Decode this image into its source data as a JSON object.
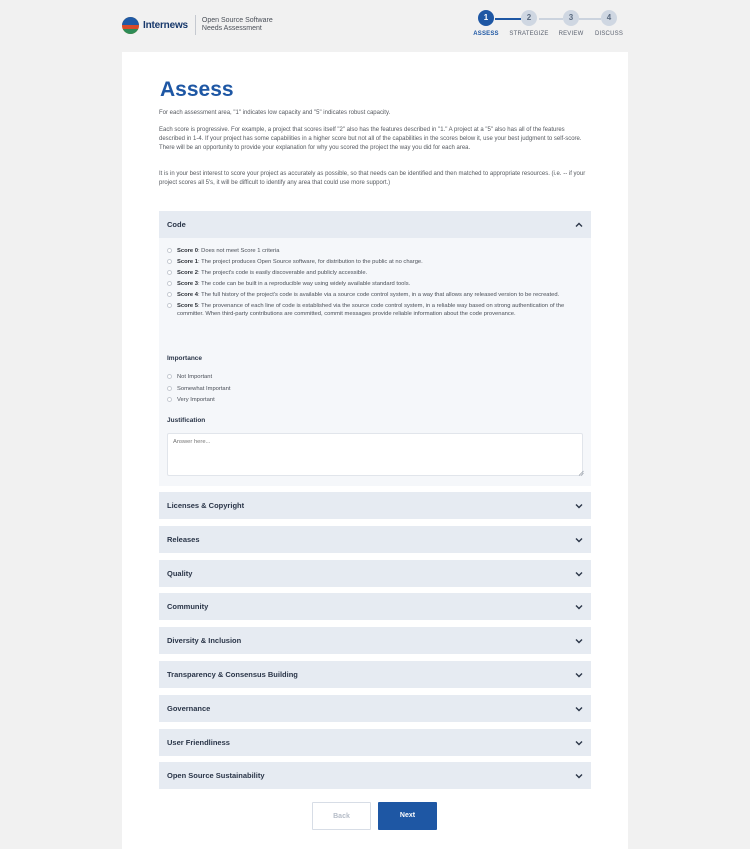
{
  "header": {
    "brand": "Internews",
    "subtitle": "Open Source Software Needs Assessment",
    "steps": [
      {
        "num": "1",
        "label": "ASSESS",
        "active": true
      },
      {
        "num": "2",
        "label": "STRATEGIZE",
        "active": false
      },
      {
        "num": "3",
        "label": "REVIEW",
        "active": false
      },
      {
        "num": "4",
        "label": "DISCUSS",
        "active": false
      }
    ]
  },
  "page": {
    "title": "Assess",
    "intro": [
      "For each assessment area, \"1\" indicates low capacity and \"5\" indicates robust capacity.",
      "Each score is progressive. For example, a project that scores itself \"2\" also has the features described in \"1.\" A project at a \"5\" also has all of the features described in 1-4. If your project has some capabilities in a higher score but not all of the capabilities in the scores below it, use your best judgment to self-score. There will be an opportunity to provide your explanation for why you scored the project the way you did for each area.",
      "It is in your best interest to score your project as accurately as possible, so that needs can be identified and then matched to appropriate resources. (i.e. -- if your project scores all 5's, it will be difficult to identify any area that could use more support.)"
    ]
  },
  "open_section": {
    "title": "Code",
    "scores": [
      {
        "label": "Score 0",
        "text": ": Does not meet Score 1 criteria"
      },
      {
        "label": "Score 1",
        "text": ": The project produces Open Source software, for distribution to the public at no charge."
      },
      {
        "label": "Score 2",
        "text": ": The project's code is easily discoverable and publicly accessible."
      },
      {
        "label": "Score 3",
        "text": ": The code can be built in a reproducible way using widely available standard tools."
      },
      {
        "label": "Score 4",
        "text": ": The full history of the project's code is available via a source code control system, in a way that allows any released version to be recreated."
      },
      {
        "label": "Score 5",
        "text": ": The provenance of each line of code is established via the source code control system, in a reliable way based on strong authentication of the committer. When third-party contributions are committed, commit messages provide reliable information about the code provenance."
      }
    ],
    "importance_title": "Importance",
    "importance_options": [
      "Not Important",
      "Somewhat Important",
      "Very Important"
    ],
    "justification_title": "Justification",
    "justification_placeholder": "Answer here..."
  },
  "sections": [
    "Licenses & Copyright",
    "Releases",
    "Quality",
    "Community",
    "Diversity & Inclusion",
    "Transparency & Consensus Building",
    "Governance",
    "User Friendliness",
    "Open Source Sustainability"
  ],
  "buttons": {
    "back": "Back",
    "next": "Next"
  },
  "icons": {
    "open_chevron": "chevron-up-icon",
    "closed_chevron": "chevron-down-icon"
  },
  "colors": {
    "primary": "#1e57a4",
    "panel": "#e6ebf2",
    "background": "#f1f1f1"
  }
}
